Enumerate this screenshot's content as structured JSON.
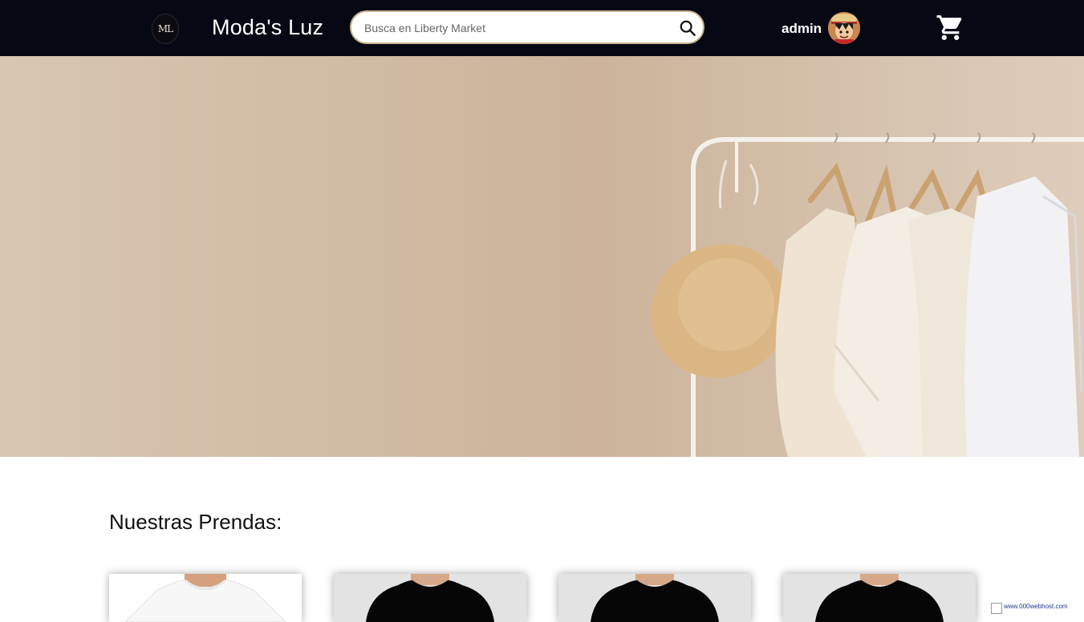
{
  "header": {
    "logo_text": "ML",
    "brand": "Moda's Luz",
    "search": {
      "placeholder": "Busca en Liberty Market",
      "value": ""
    },
    "user": {
      "name": "admin"
    },
    "icons": {
      "search": "search-icon",
      "cart": "cart-icon"
    }
  },
  "hero": {
    "image": "clothes-rack-banner"
  },
  "products": {
    "title": "Nuestras Prendas:",
    "items": [
      {
        "image": "white-tshirt"
      },
      {
        "image": "black-tshirt"
      },
      {
        "image": "black-tshirt"
      },
      {
        "image": "black-tshirt"
      }
    ]
  },
  "badge": {
    "text": "www.000webhost.com"
  },
  "colors": {
    "header_bg": "#060814",
    "search_border": "#c9b58f",
    "hero_bg": "#d3bda7"
  }
}
